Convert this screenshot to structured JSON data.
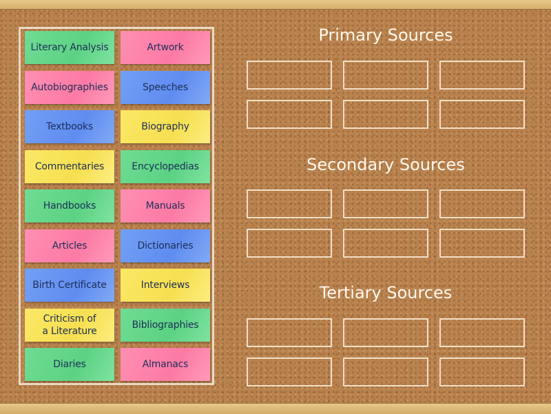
{
  "cards": [
    {
      "label": "Literary Analysis",
      "color": "green"
    },
    {
      "label": "Artwork",
      "color": "pink"
    },
    {
      "label": "Autobiographies",
      "color": "pink"
    },
    {
      "label": "Speeches",
      "color": "blue"
    },
    {
      "label": "Textbooks",
      "color": "blue"
    },
    {
      "label": "Biography",
      "color": "yellow"
    },
    {
      "label": "Commentaries",
      "color": "yellow"
    },
    {
      "label": "Encyclopedias",
      "color": "green"
    },
    {
      "label": "Handbooks",
      "color": "green"
    },
    {
      "label": "Manuals",
      "color": "pink"
    },
    {
      "label": "Articles",
      "color": "pink"
    },
    {
      "label": "Dictionaries",
      "color": "blue"
    },
    {
      "label": "Birth Certificate",
      "color": "blue"
    },
    {
      "label": "Interviews",
      "color": "yellow"
    },
    {
      "label": "Criticism of\na Literature",
      "color": "yellow"
    },
    {
      "label": "Bibliographies",
      "color": "green"
    },
    {
      "label": "Diaries",
      "color": "green"
    },
    {
      "label": "Almanacs",
      "color": "pink"
    }
  ],
  "categories": [
    {
      "title": "Primary Sources",
      "slots": 6
    },
    {
      "title": "Secondary Sources",
      "slots": 6
    },
    {
      "title": "Tertiary Sources",
      "slots": 6
    }
  ],
  "colors": {
    "green": "#5cd284",
    "pink": "#fc7aa5",
    "blue": "#5f8cf0",
    "yellow": "#f6df50",
    "text": "#1d2e57",
    "heading": "#fff8ee"
  }
}
